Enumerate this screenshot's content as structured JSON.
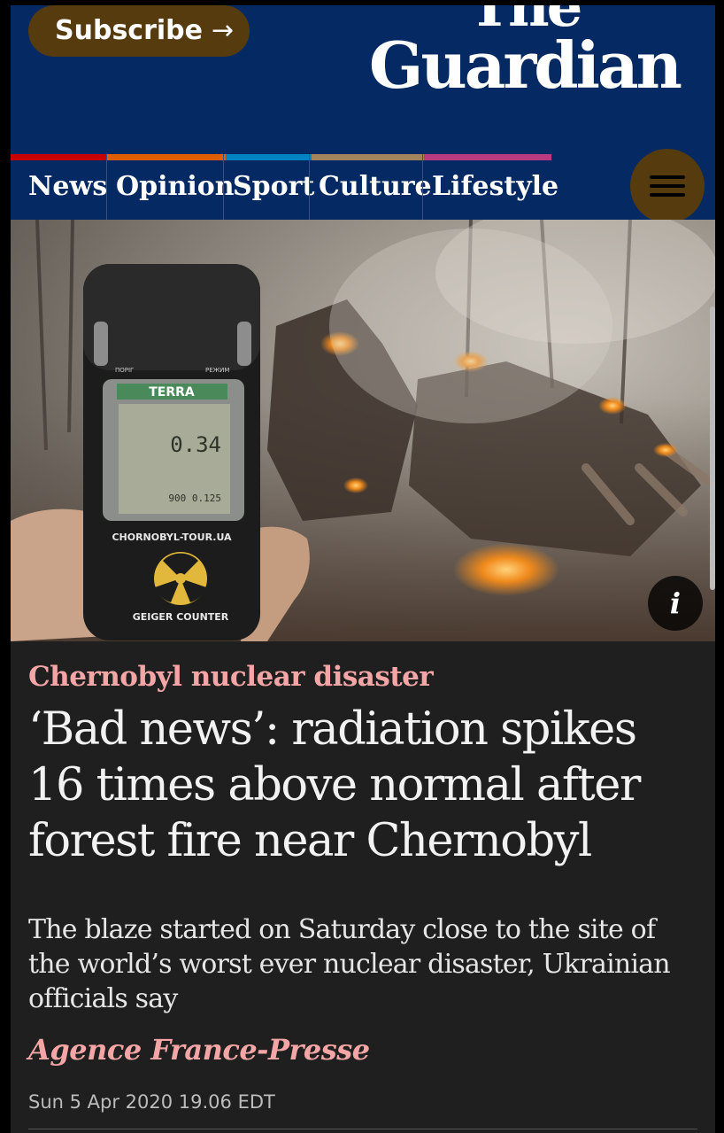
{
  "header": {
    "subscribe_label": "Subscribe",
    "subscribe_arrow": "→",
    "logo_line1": "The",
    "logo_line2": "Guardian",
    "menu_icon": "hamburger-icon"
  },
  "colors": {
    "brand_blue": "#052962",
    "subscribe_bg": "#563b0e",
    "kicker": "#f4a5a5",
    "news": "#c70000",
    "opinion": "#e05e00",
    "sport": "#0084c6",
    "culture": "#a1845c",
    "lifestyle": "#bb3b80"
  },
  "nav": {
    "pillars": [
      "News",
      "Opinion",
      "Sport",
      "Culture",
      "Lifestyle"
    ]
  },
  "hero": {
    "device_brand": "TERRA",
    "reading": "0.34",
    "reading_sub": "900 0.125",
    "device_site": "CHORNOBYL-TOUR.UA",
    "device_label": "GEIGER COUNTER",
    "button_left": "ПОРІГ",
    "button_right": "РЕЖИМ",
    "info_label": "i"
  },
  "article": {
    "kicker": "Chernobyl nuclear disaster",
    "headline": "‘Bad news’: radiation spikes 16 times above normal after forest fire near Chernobyl",
    "standfirst": "The blaze started on Saturday close to the site of the world’s worst ever nuclear disaster, Ukrainian officials say",
    "byline": "Agence France-Presse",
    "dateline": "Sun 5 Apr 2020 19.06 EDT"
  }
}
